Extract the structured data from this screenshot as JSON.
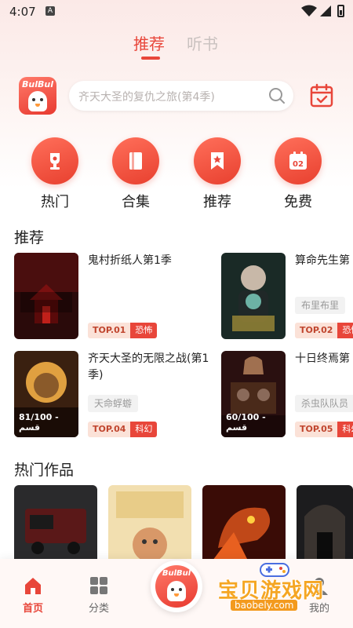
{
  "status": {
    "time": "4:07",
    "notif_letter": "A"
  },
  "top_tabs": [
    {
      "label": "推荐"
    },
    {
      "label": "听书"
    }
  ],
  "logo": {
    "text": "BulBul"
  },
  "search": {
    "placeholder": "齐天大圣的复仇之旅(第4季)"
  },
  "categories": [
    {
      "label": "热门",
      "icon": "trophy-icon"
    },
    {
      "label": "合集",
      "icon": "book-icon"
    },
    {
      "label": "推荐",
      "icon": "bookmark-star-icon"
    },
    {
      "label": "免费",
      "icon": "calendar-02-icon",
      "icon_text": "02"
    }
  ],
  "recommend": {
    "title": "推荐",
    "items": [
      {
        "title": "鬼村折纸人第1季",
        "tag": "",
        "rank": "TOP.01",
        "genre": "恐怖",
        "progress": ""
      },
      {
        "title": "算命先生第",
        "tag": "布里布里",
        "rank": "TOP.02",
        "genre": "恐怖",
        "progress": ""
      },
      {
        "title": "齐天大圣的无限之战(第1季)",
        "tag": "天命蜉蝣",
        "rank": "TOP.04",
        "genre": "科幻",
        "progress": "81/100 - قسم"
      },
      {
        "title": "十日终焉第",
        "tag": "杀虫队队员",
        "rank": "TOP.05",
        "genre": "科幻",
        "progress": "60/100 - قسم"
      }
    ]
  },
  "hot": {
    "title": "热门作品"
  },
  "bottom_nav": {
    "home": "首页",
    "category": "分类",
    "center": "BulBul",
    "mine": "我的"
  },
  "watermark": {
    "text": "宝贝游戏网",
    "url": "baobely.com"
  },
  "colors": {
    "accent": "#e8463a",
    "badge_bg": "#fbe2d8",
    "watermark": "#f5a623"
  }
}
